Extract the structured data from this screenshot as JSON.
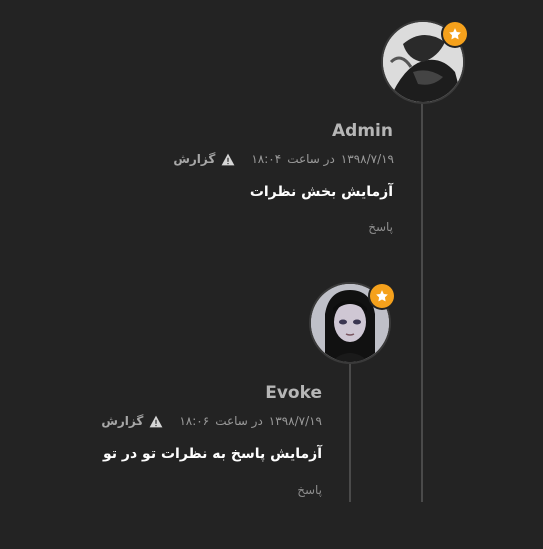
{
  "comments": [
    {
      "author": "Admin",
      "date": "۱۳۹۸/۷/۱۹",
      "at_label": "در ساعت",
      "time": "۱۸:۰۴",
      "report_label": "گزارش",
      "text": "آزمایش بخش نظرات",
      "reply_label": "پاسخ",
      "badge_icon": "star-icon",
      "badge_color": "#f5a11c"
    },
    {
      "author": "Evoke",
      "date": "۱۳۹۸/۷/۱۹",
      "at_label": "در ساعت",
      "time": "۱۸:۰۶",
      "report_label": "گزارش",
      "text": "آزمایش پاسخ به نظرات تو در تو",
      "reply_label": "پاسخ",
      "badge_icon": "star-icon",
      "badge_color": "#f5a11c"
    }
  ]
}
